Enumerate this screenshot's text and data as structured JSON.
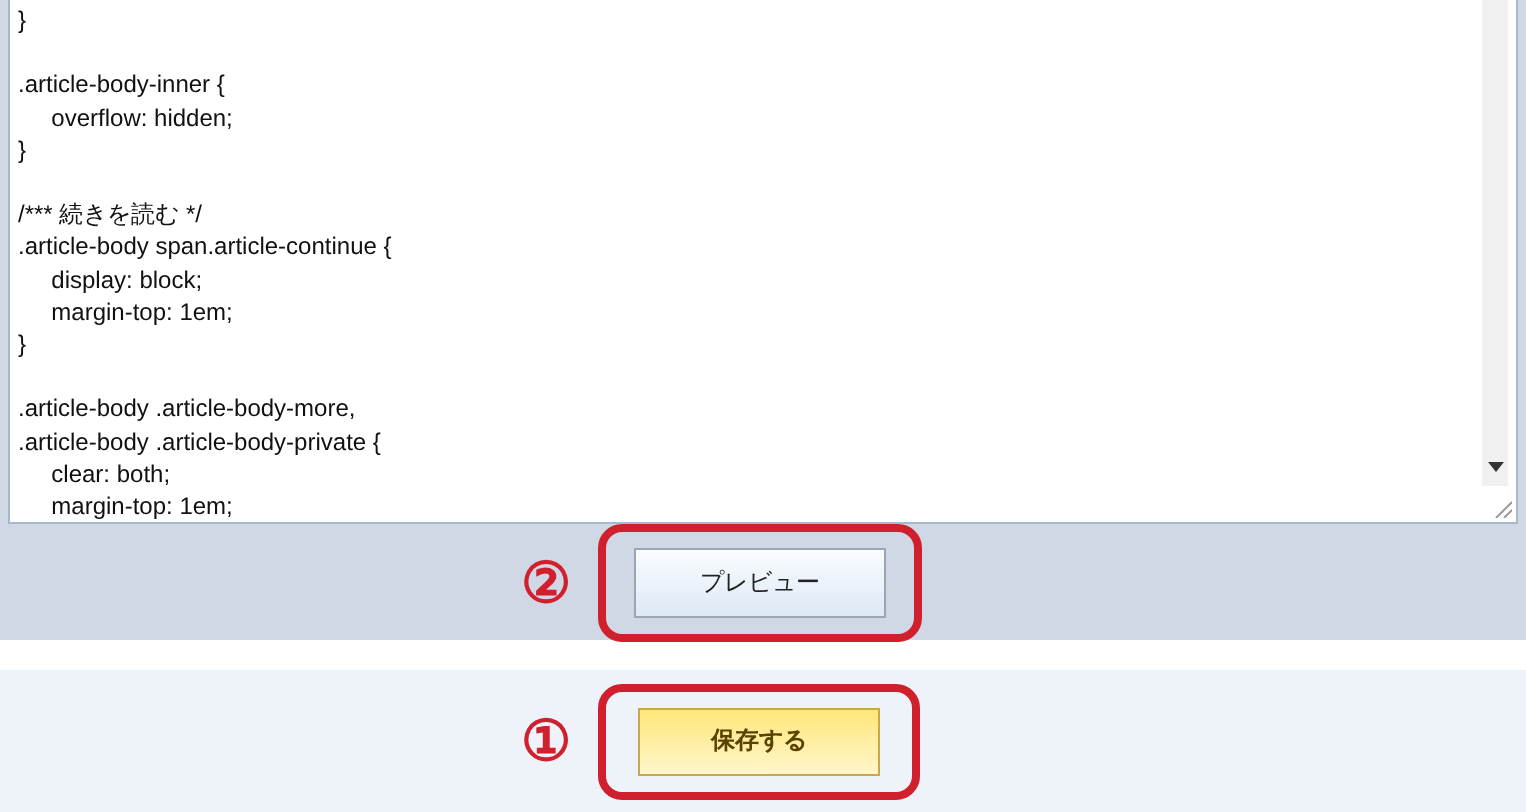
{
  "editor": {
    "value": "}\n\n.article-body-inner {\n\toverflow: hidden;\n}\n\n/*** 続きを読む */\n.article-body span.article-continue {\n\tdisplay: block;\n\tmargin-top: 1em;\n}\n\n.article-body .article-body-more,\n.article-body .article-body-private {\n\tclear: both;\n\tmargin-top: 1em;"
  },
  "preview": {
    "label": "プレビュー",
    "marker": "②"
  },
  "save": {
    "label": "保存する",
    "marker": "①"
  }
}
